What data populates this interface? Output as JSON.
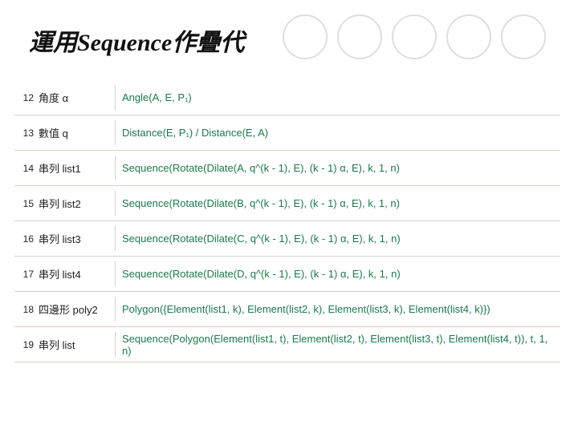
{
  "title": "運用Sequence作疊代",
  "rows": [
    {
      "num": "12",
      "label": "角度 α",
      "formula": "Angle(A, E, P₁)"
    },
    {
      "num": "13",
      "label": "數值 q",
      "formula": "Distance(E, P₁) / Distance(E, A)"
    },
    {
      "num": "14",
      "label": "串列 list1",
      "formula": "Sequence(Rotate(Dilate(A, q^(k - 1), E), (k - 1) α, E), k, 1, n)"
    },
    {
      "num": "15",
      "label": "串列 list2",
      "formula": "Sequence(Rotate(Dilate(B, q^(k - 1), E), (k - 1) α, E), k, 1, n)"
    },
    {
      "num": "16",
      "label": "串列 list3",
      "formula": "Sequence(Rotate(Dilate(C, q^(k - 1), E), (k - 1) α, E), k, 1, n)"
    },
    {
      "num": "17",
      "label": "串列 list4",
      "formula": "Sequence(Rotate(Dilate(D, q^(k - 1), E), (k - 1) α, E), k, 1, n)"
    },
    {
      "num": "18",
      "label": "四邊形 poly2",
      "formula": "Polygon({Element(list1, k), Element(list2, k), Element(list3, k), Element(list4, k)})"
    },
    {
      "num": "19",
      "label": "串列 list",
      "formula": "Sequence(Polygon(Element(list1, t), Element(list2, t), Element(list3, t), Element(list4, t)), t, 1, n)"
    }
  ]
}
